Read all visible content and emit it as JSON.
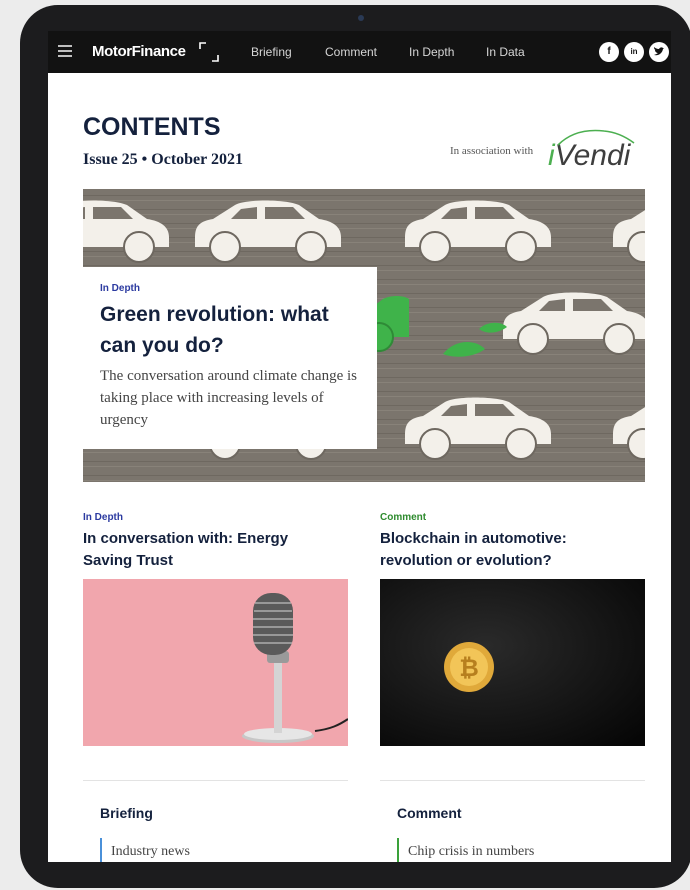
{
  "nav": {
    "logo": "MotorFinance",
    "links": [
      "Briefing",
      "Comment",
      "In Depth",
      "In Data"
    ],
    "social": [
      {
        "name": "facebook",
        "glyph": "f"
      },
      {
        "name": "linkedin",
        "glyph": "in"
      },
      {
        "name": "twitter",
        "glyph": "t"
      }
    ]
  },
  "header": {
    "title": "CONTENTS",
    "issue": "Issue 25 • October 2021",
    "association": "In association with",
    "partner": "iVendi"
  },
  "hero": {
    "kicker": "In Depth",
    "title": "Green revolution: what can you do?",
    "description": "The conversation around climate change is taking place with increasing levels of urgency"
  },
  "articles": [
    {
      "kicker": "In Depth",
      "title": "In conversation with: Energy Saving Trust",
      "kicker_color": "#2b3aa0"
    },
    {
      "kicker": "Comment",
      "title": "Blockchain in automotive: revolution or evolution?",
      "kicker_color": "#2e8b2e"
    }
  ],
  "sections": [
    {
      "title": "Briefing",
      "item": "Industry news"
    },
    {
      "title": "Comment",
      "item": "Chip crisis in numbers"
    }
  ],
  "colors": {
    "accent_blue": "#2b3aa0",
    "accent_green": "#2e8b2e",
    "title_navy": "#14213d",
    "nav_bg": "#121212"
  }
}
